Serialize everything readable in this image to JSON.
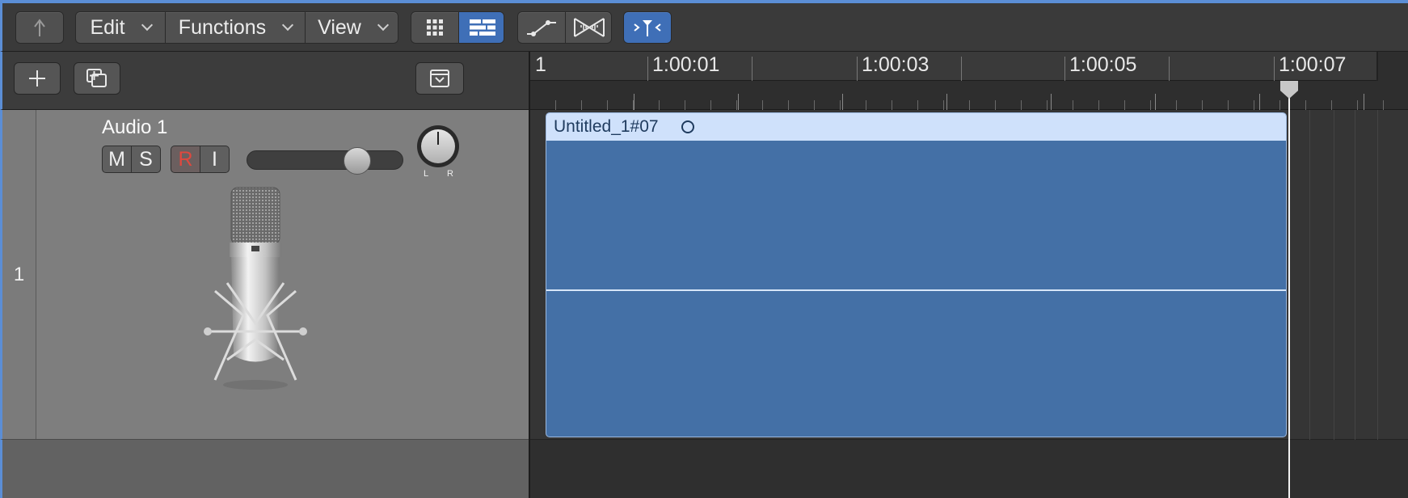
{
  "toolbar": {
    "menus": [
      {
        "label": "Edit"
      },
      {
        "label": "Functions"
      },
      {
        "label": "View"
      }
    ]
  },
  "ruler": {
    "labels": [
      "1",
      "1:00:01",
      "1:00:03",
      "1:00:05",
      "1:00:07"
    ]
  },
  "track": {
    "number": "1",
    "name": "Audio 1",
    "mute_label": "M",
    "solo_label": "S",
    "record_label": "R",
    "input_label": "I",
    "pan_left": "L",
    "pan_right": "R",
    "volume_level": 0.75,
    "colors": {
      "record": "#e0483e"
    }
  },
  "region": {
    "name": "Untitled_1#07"
  },
  "colors": {
    "accent": "#5b8ed6",
    "region_body": "#4470a6",
    "region_header": "#cfe1fb",
    "active_button": "#3f6fb7"
  },
  "icons": {
    "back": "back-arrow-icon",
    "grid": "grid-view-icon",
    "list": "list-view-icon",
    "automation": "automation-curve-icon",
    "flex": "flex-icon",
    "catch": "catch-playhead-icon",
    "add": "plus-icon",
    "duplicate": "duplicate-track-icon",
    "collapse": "collapse-icon"
  }
}
